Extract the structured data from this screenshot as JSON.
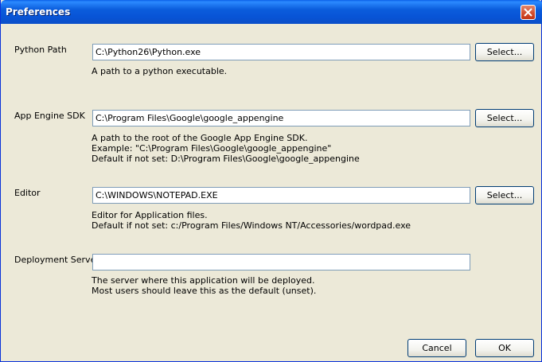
{
  "window": {
    "title": "Preferences"
  },
  "python_path": {
    "label": "Python Path",
    "value": "C:\\Python26\\Python.exe",
    "help": [
      "A path to a python executable."
    ],
    "button": "Select..."
  },
  "sdk": {
    "label": "App Engine SDK",
    "value": "C:\\Program Files\\Google\\google_appengine",
    "help": [
      "A path to the root of the Google App Engine SDK.",
      "Example: \"C:\\Program Files\\Google\\google_appengine\"",
      "Default if not set: D:\\Program Files\\Google\\google_appengine"
    ],
    "button": "Select..."
  },
  "editor": {
    "label": "Editor",
    "value": "C:\\WINDOWS\\NOTEPAD.EXE",
    "help": [
      "Editor for Application files.",
      "Default if not set: c:/Program Files/Windows NT/Accessories/wordpad.exe"
    ],
    "button": "Select..."
  },
  "deploy": {
    "label": "Deployment Server",
    "value": "",
    "help": [
      "The server where this application will be deployed.",
      "Most users should leave this as the default (unset)."
    ]
  },
  "footer": {
    "cancel": "Cancel",
    "ok": "OK"
  }
}
